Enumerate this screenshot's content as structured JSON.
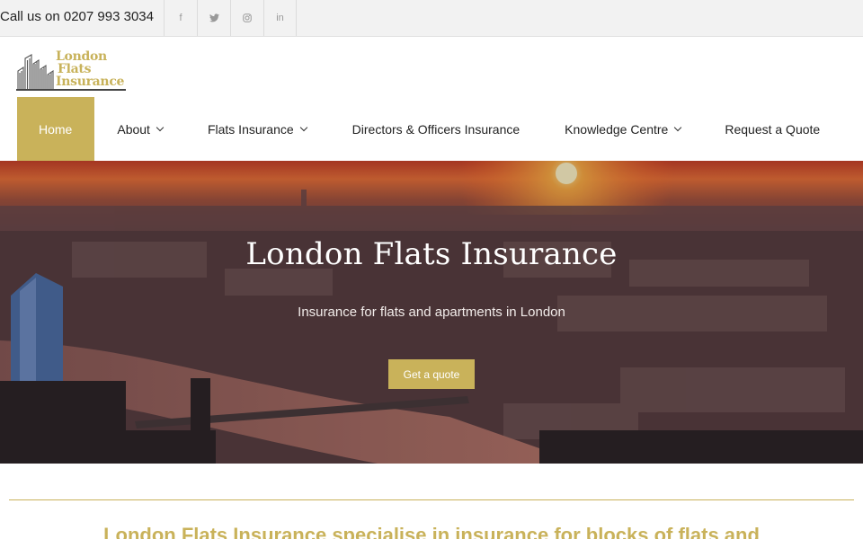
{
  "topbar": {
    "phone": "Call us on 0207 993 3034",
    "social": [
      {
        "icon": "facebook-icon",
        "glyph": "f"
      },
      {
        "icon": "twitter-icon",
        "glyph": "t"
      },
      {
        "icon": "instagram-icon",
        "glyph": "◎"
      },
      {
        "icon": "linkedin-icon",
        "glyph": "in"
      }
    ]
  },
  "logo": {
    "line1": "London",
    "line2": "Flats",
    "line3": "Insurance"
  },
  "nav": {
    "items": [
      {
        "label": "Home"
      },
      {
        "label": "About"
      },
      {
        "label": "Flats Insurance"
      },
      {
        "label": "Directors & Officers Insurance"
      },
      {
        "label": "Knowledge Centre"
      },
      {
        "label": "Request a Quote"
      }
    ]
  },
  "hero": {
    "title": "London Flats Insurance",
    "subtitle": "Insurance for flats and apartments in London",
    "button": "Get a quote"
  },
  "intro": {
    "heading": "London Flats Insurance specialise in insurance for blocks of flats and"
  },
  "colors": {
    "accent": "#c9b25a",
    "topbar": "#f2f2f2"
  }
}
